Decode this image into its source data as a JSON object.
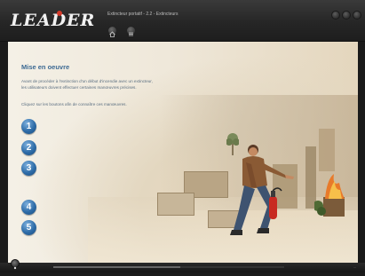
{
  "app": {
    "logo": "LEADER",
    "window_title": "Extincteur portatif - 2.2 - Extincteurs"
  },
  "content": {
    "heading": "Mise en oeuvre",
    "intro_line1": "Avant de procéder à l'extinction d'un début d'incendie avec un extincteur,",
    "intro_line2": "les utilisateurs doivent effectuer certaines manœuvres précises.",
    "instruction": "Cliquez sur les boutons afin de connaître ces manœuvres.",
    "steps": [
      "1",
      "2",
      "3",
      "4",
      "5"
    ]
  },
  "footer": {
    "progress": 0.55,
    "status_text": "..."
  },
  "colors": {
    "accent": "#d43a2a",
    "heading": "#3d6a93",
    "step_button": "#2e6ca8"
  },
  "icons": {
    "nav_home": "home-icon",
    "nav_menu": "menu-icon",
    "bottom": "menu-icon"
  }
}
